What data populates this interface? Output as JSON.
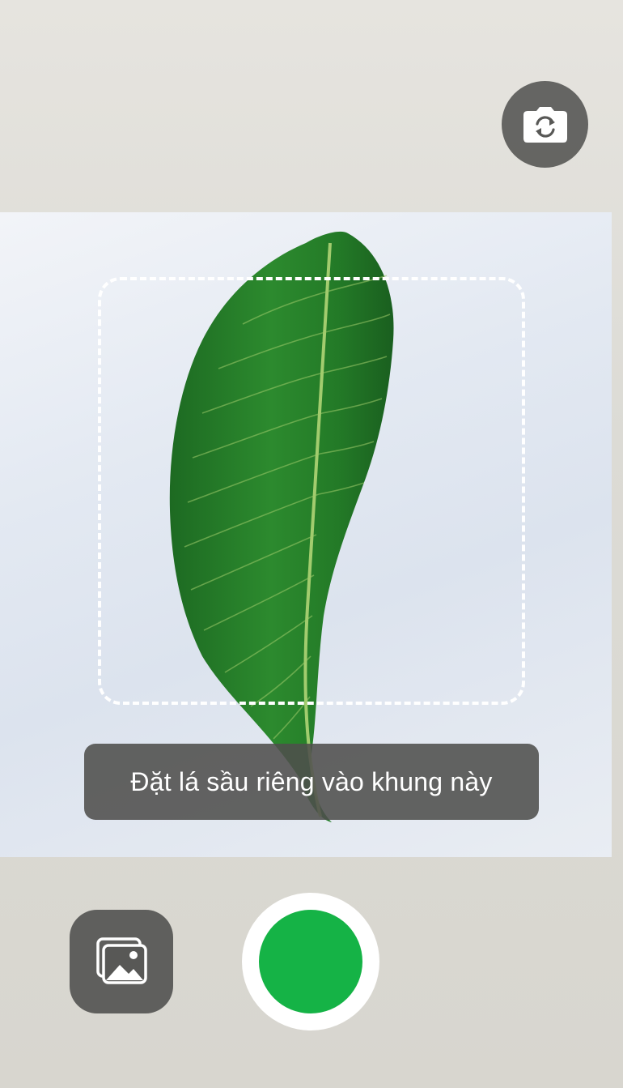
{
  "screen": "camera-capture",
  "camera_controls": {
    "switch_camera_icon": "camera-switch-icon",
    "gallery_icon": "image-gallery-icon"
  },
  "hint": {
    "text": "Đặt lá sầu riêng vào khung này"
  },
  "colors": {
    "shutter": "#15b346",
    "hint_background": "#4e4e4c",
    "control_background": "#585856",
    "frame_border": "#ffffff"
  }
}
